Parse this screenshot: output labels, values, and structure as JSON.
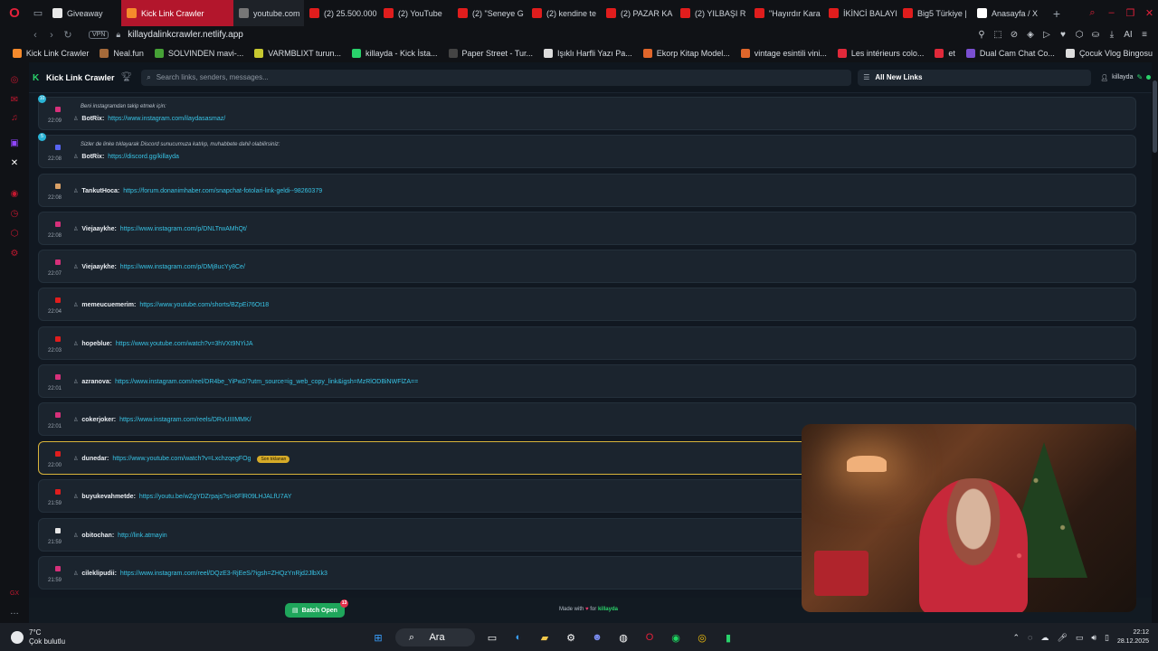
{
  "browser": {
    "tabs": [
      {
        "label": "Giveaway",
        "favicon": "#e8e8e8"
      },
      {
        "label": "Kick Link Crawler",
        "favicon": "#f58a2c",
        "active": true
      },
      {
        "label": "youtube.com",
        "favicon": "#777"
      },
      {
        "label": "(2) 25.500.000",
        "favicon": "#e01d1d"
      },
      {
        "label": "(2) YouTube",
        "favicon": "#e01d1d"
      },
      {
        "label": "(2) \"Seneye G",
        "favicon": "#e01d1d"
      },
      {
        "label": "(2) kendine te",
        "favicon": "#e01d1d"
      },
      {
        "label": "(2) PAZAR KA",
        "favicon": "#e01d1d"
      },
      {
        "label": "(2) YILBAŞI R",
        "favicon": "#e01d1d"
      },
      {
        "label": "\"Hayırdır Kara",
        "favicon": "#e01d1d"
      },
      {
        "label": "İKİNCİ BALAYI",
        "favicon": "#e01d1d"
      },
      {
        "label": "Big5 Türkiye |",
        "favicon": "#e01d1d"
      },
      {
        "label": "Anasayfa / X",
        "favicon": "#ffffff"
      }
    ],
    "vpn_label": "VPN",
    "url": "killaydalinkcrawler.netlify.app",
    "addr_ai": "AI",
    "bookmarks": [
      {
        "label": "Kick Link Crawler",
        "color": "#f58a2c"
      },
      {
        "label": "Neal.fun",
        "color": "#a56a3a"
      },
      {
        "label": "SOLVINDEN mavi-...",
        "color": "#46a136"
      },
      {
        "label": "VARMBLIXT turun...",
        "color": "#c7c830"
      },
      {
        "label": "killayda - Kick İsta...",
        "color": "#29d26b"
      },
      {
        "label": "Paper Street - Tur...",
        "color": "#444"
      },
      {
        "label": "Işıklı Harfli Yazı Pa...",
        "color": "#ddd"
      },
      {
        "label": "Ekorp Kitap Model...",
        "color": "#e0662b"
      },
      {
        "label": "vintage esintili vini...",
        "color": "#e0662b"
      },
      {
        "label": "Les intérieurs colo...",
        "color": "#e0293a"
      },
      {
        "label": "et",
        "color": "#e0293a"
      },
      {
        "label": "Dual Cam Chat Co...",
        "color": "#7a4fd1"
      },
      {
        "label": "Çocuk Vlog Bingosu",
        "color": "#ddd"
      }
    ]
  },
  "app": {
    "brand": "Kick Link Crawler",
    "search_placeholder": "Search links, senders, messages...",
    "filter_label": "All New Links",
    "user": "killayda"
  },
  "feed": [
    {
      "platform": "instagram",
      "time": "22:09",
      "sender": "BotRix:",
      "link": "https://www.instagram.com/ilaydasasmaz/",
      "message": "Beni instagramdan takip etmek için:",
      "badge": "10"
    },
    {
      "platform": "discord",
      "time": "22:08",
      "sender": "BotRix:",
      "link": "https://discord.gg/killayda",
      "message": "Sizler de linke tıklayarak Discord sunucumuza katılıp, muhabbete dahil olabilirsiniz:",
      "badge": "5"
    },
    {
      "platform": "other",
      "time": "22:08",
      "sender": "TankutHoca:",
      "link": "https://forum.donanimhaber.com/snapchat-fotolari-link-geldi--98260379"
    },
    {
      "platform": "instagram",
      "time": "22:08",
      "sender": "Viejaaykhe:",
      "link": "https://www.instagram.com/p/DNLTrwAMhQt/"
    },
    {
      "platform": "instagram",
      "time": "22:07",
      "sender": "Viejaaykhe:",
      "link": "https://www.instagram.com/p/DMj8ucYy8Ce/"
    },
    {
      "platform": "youtube",
      "time": "22:04",
      "sender": "memeucuemerim:",
      "link": "https://www.youtube.com/shorts/BZpEi76Ot18"
    },
    {
      "platform": "youtube",
      "time": "22:03",
      "sender": "hopeblue:",
      "link": "https://www.youtube.com/watch?v=3hVXt9NYiJA"
    },
    {
      "platform": "instagram",
      "time": "22:01",
      "sender": "azranova:",
      "link": "https://www.instagram.com/reel/DR4be_YiPw2/?utm_source=ig_web_copy_link&igsh=MzRlODBiNWFlZA=="
    },
    {
      "platform": "instagram",
      "time": "22:01",
      "sender": "cokerjoker:",
      "link": "https://www.instagram.com/reels/DRvUIIIMMK/"
    },
    {
      "platform": "youtube",
      "time": "22:00",
      "sender": "dunedar:",
      "link": "https://www.youtube.com/watch?v=LxchzqegFOg",
      "tag": "Son tıklanan",
      "highlight": true
    },
    {
      "platform": "youtube",
      "time": "21:59",
      "sender": "buyukevahmetde:",
      "link": "https://youtu.be/wZgYDZrpajs?si=6FlR09LHJALfU7AY"
    },
    {
      "platform": "other-white",
      "time": "21:59",
      "sender": "obitochan:",
      "link": "http://link.atmayin"
    },
    {
      "platform": "instagram",
      "time": "21:59",
      "sender": "cileklipudii:",
      "link": "https://www.instagram.com/reel/DQzE3-RjEeS/?igsh=ZHQzYnRjd2JlbXk3"
    }
  ],
  "footer": {
    "batch_label": "Batch Open",
    "batch_count": "13",
    "made_with_pre": "Made with",
    "made_with_mid": "for",
    "made_with_name": "killayda"
  },
  "taskbar": {
    "temp": "7°C",
    "weather": "Çok bulutlu",
    "search": "Ara",
    "time": "22:12",
    "date": "28.12.2025"
  },
  "colors": {
    "accent_green": "#29d26b",
    "link": "#38c4e6",
    "tab_active": "#b3162c",
    "highlight_border": "#d9b43a"
  }
}
